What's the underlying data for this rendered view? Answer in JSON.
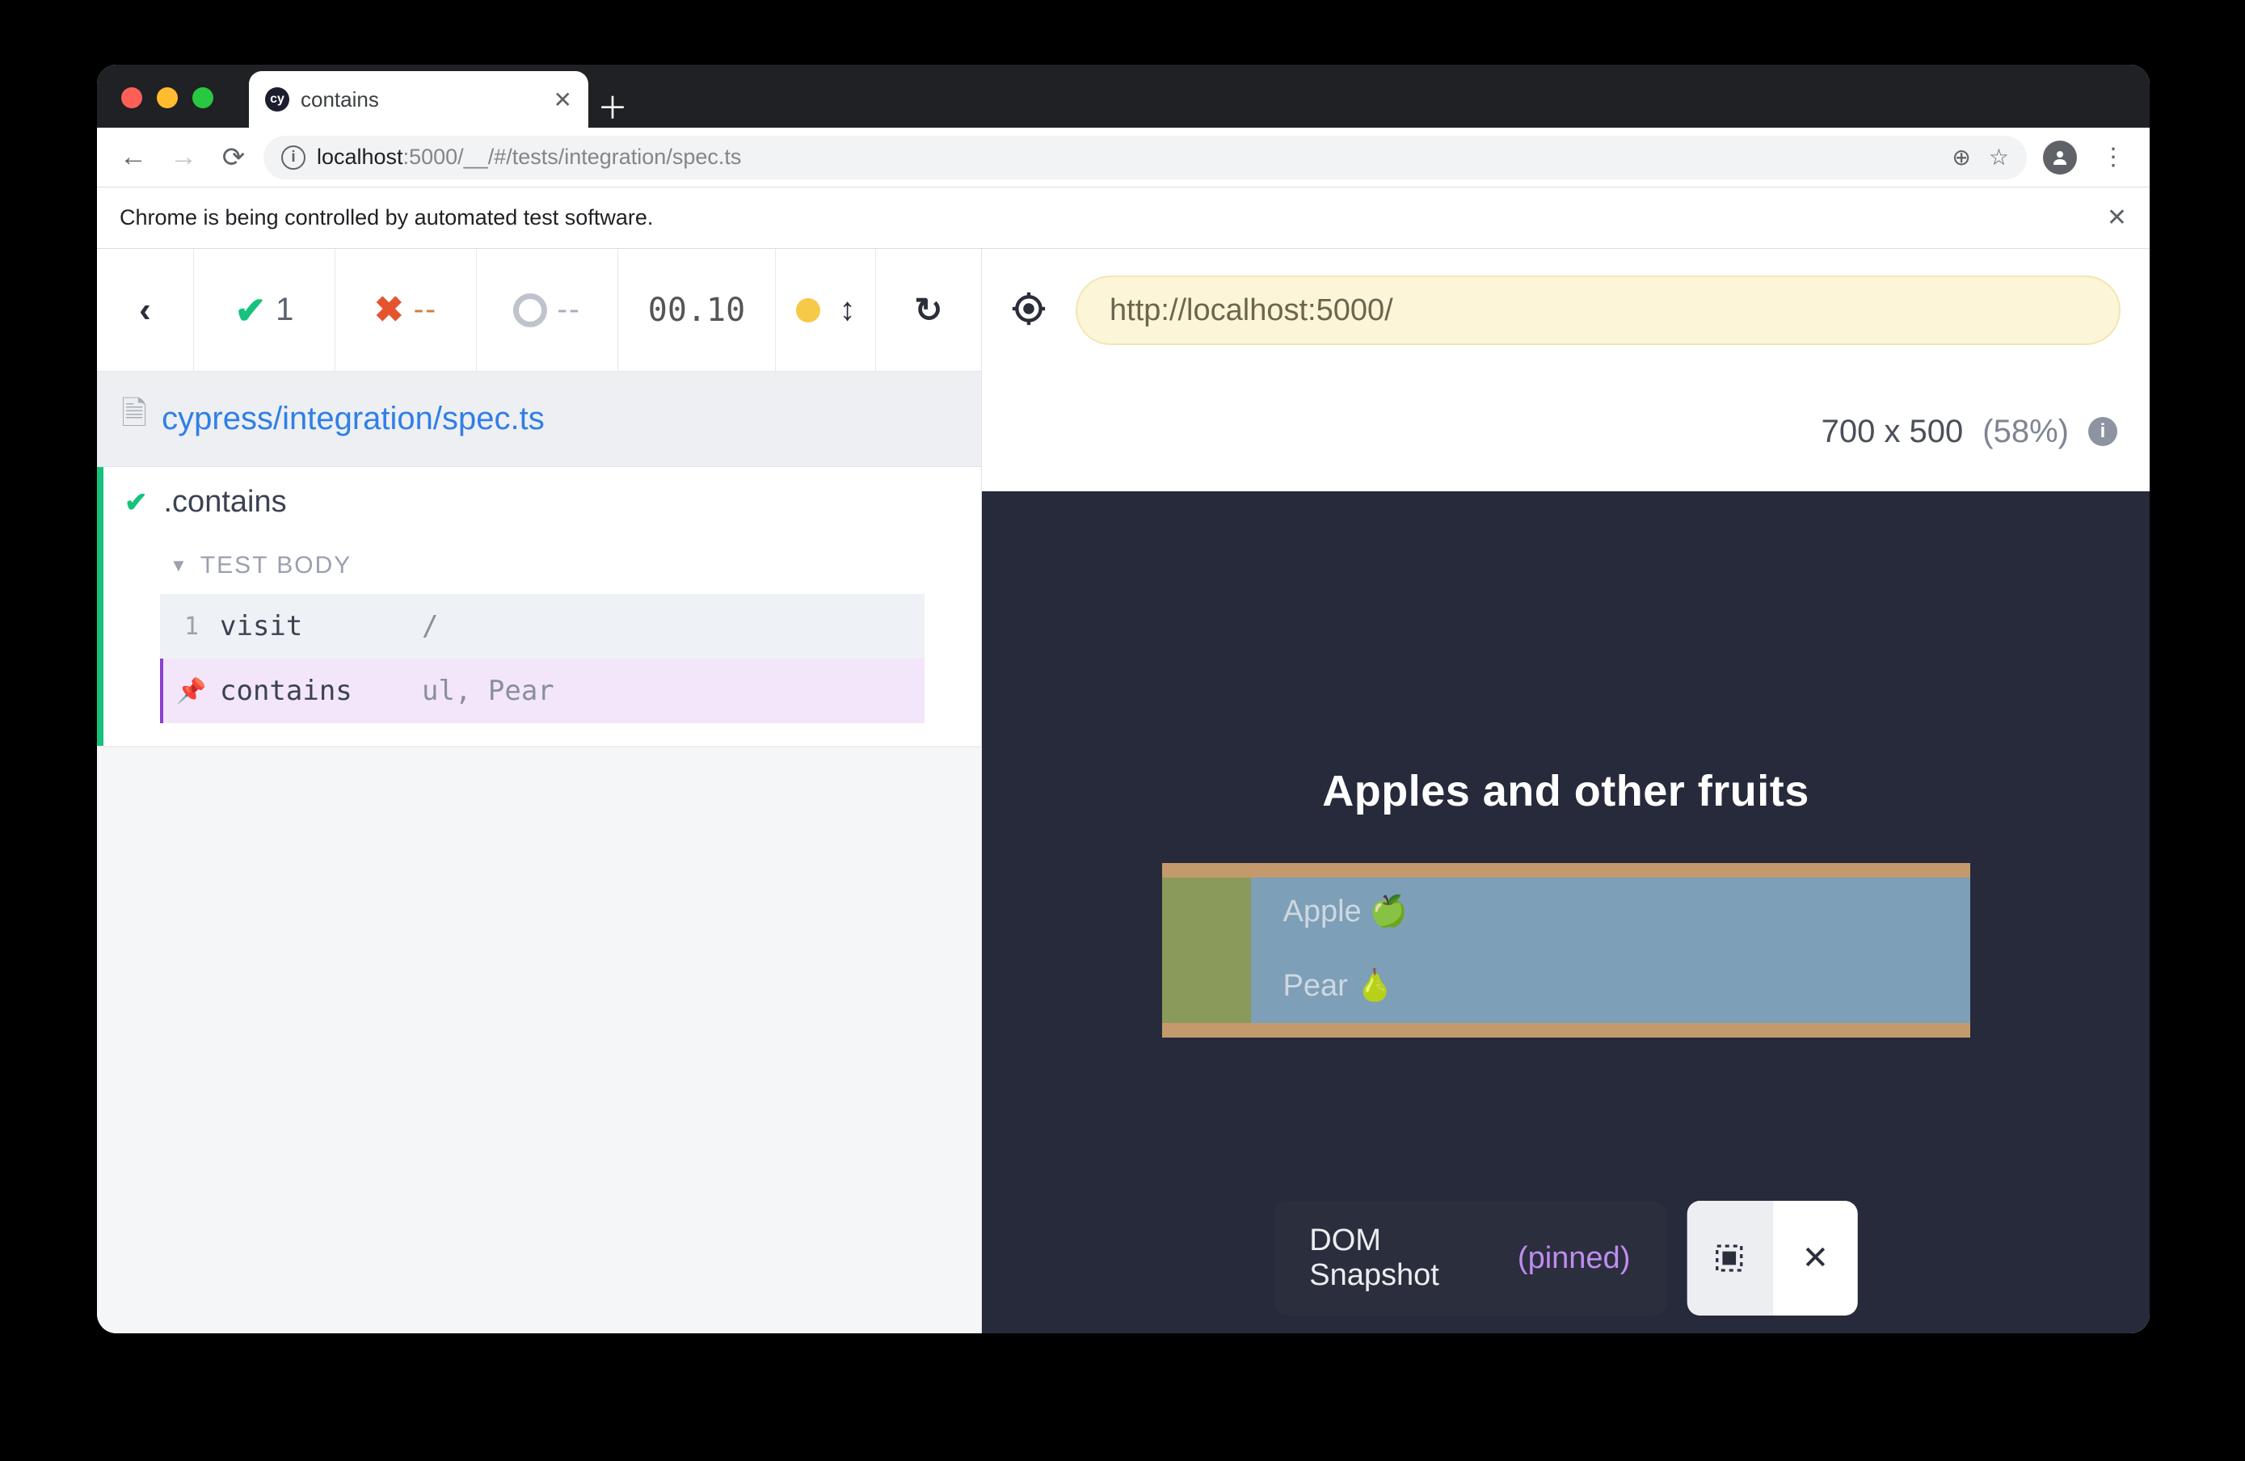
{
  "browser": {
    "tab_title": "contains",
    "favicon_text": "cy",
    "url_host": "localhost",
    "url_port": ":5000",
    "url_path": "/__/#/tests/integration/spec.ts"
  },
  "automation_banner": "Chrome is being controlled by automated test software.",
  "stats": {
    "passed": "1",
    "failed": "--",
    "pending": "--",
    "duration": "00.10"
  },
  "spec_path": "cypress/integration/spec.ts",
  "test": {
    "title": ".contains",
    "body_label": "TEST BODY",
    "commands": [
      {
        "idx": "1",
        "name": "visit",
        "args": "/",
        "pinned": false
      },
      {
        "idx": "",
        "name": "contains",
        "args": "ul, Pear",
        "pinned": true
      }
    ]
  },
  "aut": {
    "url": "http://localhost:5000/",
    "viewport_dims": "700 x 500",
    "viewport_scale": "(58%)",
    "heading": "Apples and other fruits",
    "items": [
      {
        "label": "Apple",
        "emoji": "🍏"
      },
      {
        "label": "Pear",
        "emoji": "🍐"
      }
    ]
  },
  "snapshot": {
    "label": "DOM Snapshot",
    "state": "(pinned)"
  }
}
